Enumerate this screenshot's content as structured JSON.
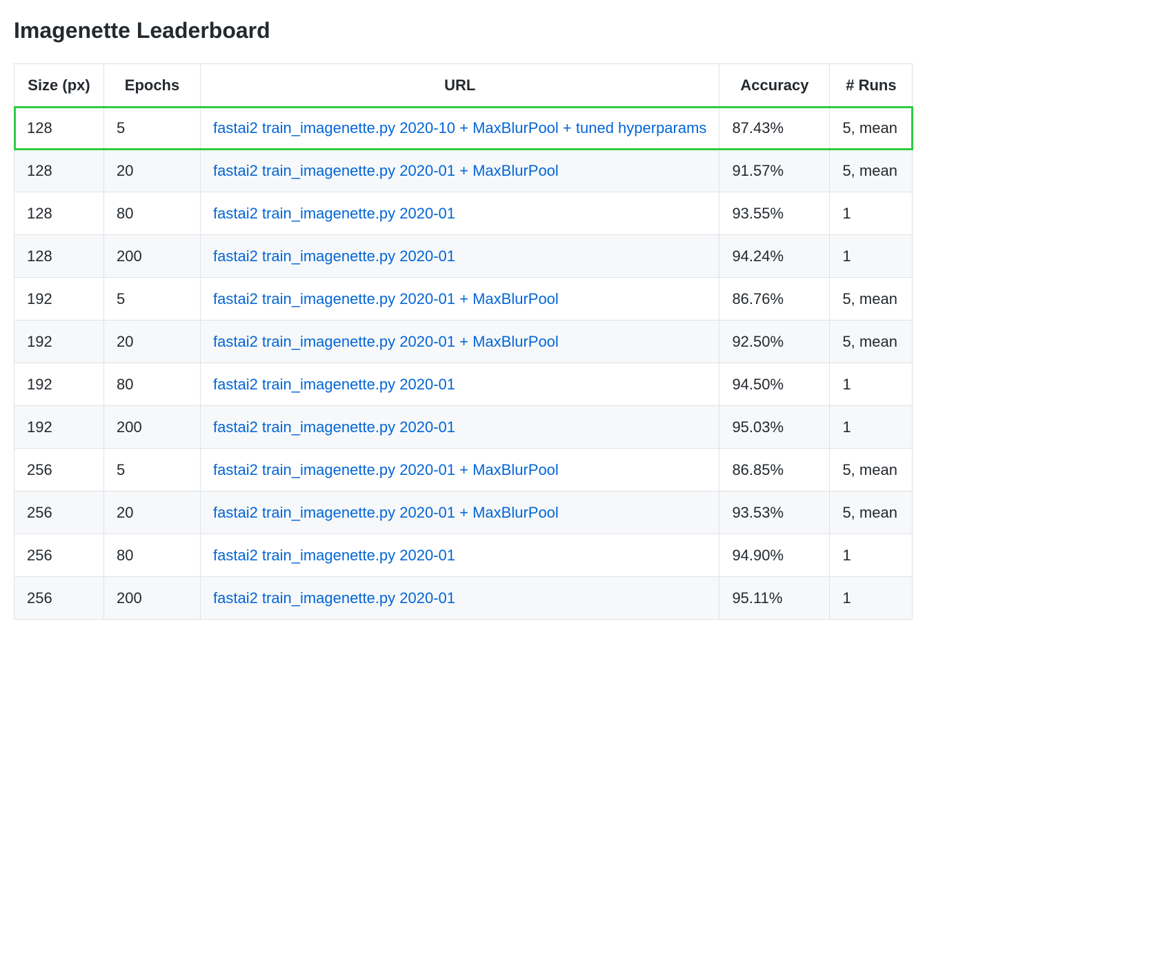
{
  "title": "Imagenette Leaderboard",
  "headers": {
    "size": "Size (px)",
    "epochs": "Epochs",
    "url": "URL",
    "accuracy": "Accuracy",
    "runs": "# Runs"
  },
  "rows": [
    {
      "size": "128",
      "epochs": "5",
      "url_text": "fastai2 train_imagenette.py 2020-10 + MaxBlurPool + tuned hyperparams",
      "accuracy": "87.43%",
      "runs": "5, mean",
      "highlighted": true
    },
    {
      "size": "128",
      "epochs": "20",
      "url_text": "fastai2 train_imagenette.py 2020-01 + MaxBlurPool",
      "accuracy": "91.57%",
      "runs": "5, mean",
      "highlighted": false
    },
    {
      "size": "128",
      "epochs": "80",
      "url_text": "fastai2 train_imagenette.py 2020-01",
      "accuracy": "93.55%",
      "runs": "1",
      "highlighted": false
    },
    {
      "size": "128",
      "epochs": "200",
      "url_text": "fastai2 train_imagenette.py 2020-01",
      "accuracy": "94.24%",
      "runs": "1",
      "highlighted": false
    },
    {
      "size": "192",
      "epochs": "5",
      "url_text": "fastai2 train_imagenette.py 2020-01 + MaxBlurPool",
      "accuracy": "86.76%",
      "runs": "5, mean",
      "highlighted": false
    },
    {
      "size": "192",
      "epochs": "20",
      "url_text": "fastai2 train_imagenette.py 2020-01 + MaxBlurPool",
      "accuracy": "92.50%",
      "runs": "5, mean",
      "highlighted": false
    },
    {
      "size": "192",
      "epochs": "80",
      "url_text": "fastai2 train_imagenette.py 2020-01",
      "accuracy": "94.50%",
      "runs": "1",
      "highlighted": false
    },
    {
      "size": "192",
      "epochs": "200",
      "url_text": "fastai2 train_imagenette.py 2020-01",
      "accuracy": "95.03%",
      "runs": "1",
      "highlighted": false
    },
    {
      "size": "256",
      "epochs": "5",
      "url_text": "fastai2 train_imagenette.py 2020-01 + MaxBlurPool",
      "accuracy": "86.85%",
      "runs": "5, mean",
      "highlighted": false
    },
    {
      "size": "256",
      "epochs": "20",
      "url_text": "fastai2 train_imagenette.py 2020-01 + MaxBlurPool",
      "accuracy": "93.53%",
      "runs": "5, mean",
      "highlighted": false
    },
    {
      "size": "256",
      "epochs": "80",
      "url_text": "fastai2 train_imagenette.py 2020-01",
      "accuracy": "94.90%",
      "runs": "1",
      "highlighted": false
    },
    {
      "size": "256",
      "epochs": "200",
      "url_text": "fastai2 train_imagenette.py 2020-01",
      "accuracy": "95.11%",
      "runs": "1",
      "highlighted": false
    }
  ]
}
